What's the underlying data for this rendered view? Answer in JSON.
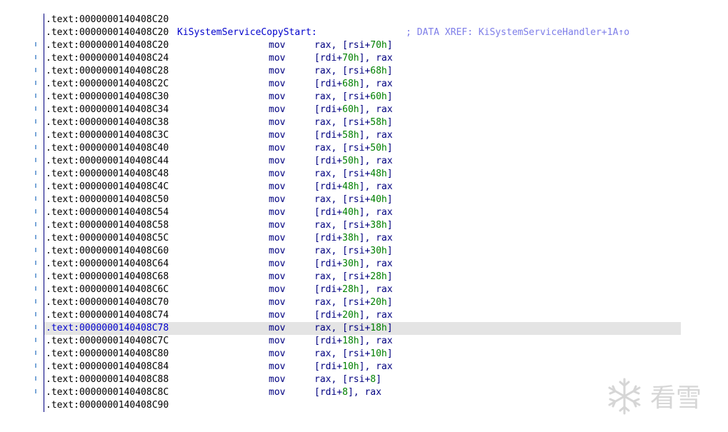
{
  "listing": [
    {
      "addr": ".text:0000000140408C20",
      "label": "",
      "xref": "",
      "mnem": "",
      "ops": "",
      "flow": false,
      "selected": false
    },
    {
      "addr": ".text:0000000140408C20",
      "label": "KiSystemServiceCopyStart:",
      "xref": "; DATA XREF: KiSystemServiceHandler+1A↑o",
      "mnem": "",
      "ops": "",
      "flow": false,
      "selected": false
    },
    {
      "addr": ".text:0000000140408C20",
      "label": "",
      "xref": "",
      "mnem": "mov",
      "ops": "rax, [rsi+70h]",
      "flow": true,
      "selected": false
    },
    {
      "addr": ".text:0000000140408C24",
      "label": "",
      "xref": "",
      "mnem": "mov",
      "ops": "[rdi+70h], rax",
      "flow": true,
      "selected": false
    },
    {
      "addr": ".text:0000000140408C28",
      "label": "",
      "xref": "",
      "mnem": "mov",
      "ops": "rax, [rsi+68h]",
      "flow": true,
      "selected": false
    },
    {
      "addr": ".text:0000000140408C2C",
      "label": "",
      "xref": "",
      "mnem": "mov",
      "ops": "[rdi+68h], rax",
      "flow": true,
      "selected": false
    },
    {
      "addr": ".text:0000000140408C30",
      "label": "",
      "xref": "",
      "mnem": "mov",
      "ops": "rax, [rsi+60h]",
      "flow": true,
      "selected": false
    },
    {
      "addr": ".text:0000000140408C34",
      "label": "",
      "xref": "",
      "mnem": "mov",
      "ops": "[rdi+60h], rax",
      "flow": true,
      "selected": false
    },
    {
      "addr": ".text:0000000140408C38",
      "label": "",
      "xref": "",
      "mnem": "mov",
      "ops": "rax, [rsi+58h]",
      "flow": true,
      "selected": false
    },
    {
      "addr": ".text:0000000140408C3C",
      "label": "",
      "xref": "",
      "mnem": "mov",
      "ops": "[rdi+58h], rax",
      "flow": true,
      "selected": false
    },
    {
      "addr": ".text:0000000140408C40",
      "label": "",
      "xref": "",
      "mnem": "mov",
      "ops": "rax, [rsi+50h]",
      "flow": true,
      "selected": false
    },
    {
      "addr": ".text:0000000140408C44",
      "label": "",
      "xref": "",
      "mnem": "mov",
      "ops": "[rdi+50h], rax",
      "flow": true,
      "selected": false
    },
    {
      "addr": ".text:0000000140408C48",
      "label": "",
      "xref": "",
      "mnem": "mov",
      "ops": "rax, [rsi+48h]",
      "flow": true,
      "selected": false
    },
    {
      "addr": ".text:0000000140408C4C",
      "label": "",
      "xref": "",
      "mnem": "mov",
      "ops": "[rdi+48h], rax",
      "flow": true,
      "selected": false
    },
    {
      "addr": ".text:0000000140408C50",
      "label": "",
      "xref": "",
      "mnem": "mov",
      "ops": "rax, [rsi+40h]",
      "flow": true,
      "selected": false
    },
    {
      "addr": ".text:0000000140408C54",
      "label": "",
      "xref": "",
      "mnem": "mov",
      "ops": "[rdi+40h], rax",
      "flow": true,
      "selected": false
    },
    {
      "addr": ".text:0000000140408C58",
      "label": "",
      "xref": "",
      "mnem": "mov",
      "ops": "rax, [rsi+38h]",
      "flow": true,
      "selected": false
    },
    {
      "addr": ".text:0000000140408C5C",
      "label": "",
      "xref": "",
      "mnem": "mov",
      "ops": "[rdi+38h], rax",
      "flow": true,
      "selected": false
    },
    {
      "addr": ".text:0000000140408C60",
      "label": "",
      "xref": "",
      "mnem": "mov",
      "ops": "rax, [rsi+30h]",
      "flow": true,
      "selected": false
    },
    {
      "addr": ".text:0000000140408C64",
      "label": "",
      "xref": "",
      "mnem": "mov",
      "ops": "[rdi+30h], rax",
      "flow": true,
      "selected": false
    },
    {
      "addr": ".text:0000000140408C68",
      "label": "",
      "xref": "",
      "mnem": "mov",
      "ops": "rax, [rsi+28h]",
      "flow": true,
      "selected": false
    },
    {
      "addr": ".text:0000000140408C6C",
      "label": "",
      "xref": "",
      "mnem": "mov",
      "ops": "[rdi+28h], rax",
      "flow": true,
      "selected": false
    },
    {
      "addr": ".text:0000000140408C70",
      "label": "",
      "xref": "",
      "mnem": "mov",
      "ops": "rax, [rsi+20h]",
      "flow": true,
      "selected": false
    },
    {
      "addr": ".text:0000000140408C74",
      "label": "",
      "xref": "",
      "mnem": "mov",
      "ops": "[rdi+20h], rax",
      "flow": true,
      "selected": false
    },
    {
      "addr": ".text:0000000140408C78",
      "label": "",
      "xref": "",
      "mnem": "mov",
      "ops": "rax, [rsi+18h]",
      "flow": true,
      "selected": true
    },
    {
      "addr": ".text:0000000140408C7C",
      "label": "",
      "xref": "",
      "mnem": "mov",
      "ops": "[rdi+18h], rax",
      "flow": true,
      "selected": false
    },
    {
      "addr": ".text:0000000140408C80",
      "label": "",
      "xref": "",
      "mnem": "mov",
      "ops": "rax, [rsi+10h]",
      "flow": true,
      "selected": false
    },
    {
      "addr": ".text:0000000140408C84",
      "label": "",
      "xref": "",
      "mnem": "mov",
      "ops": "[rdi+10h], rax",
      "flow": true,
      "selected": false
    },
    {
      "addr": ".text:0000000140408C88",
      "label": "",
      "xref": "",
      "mnem": "mov",
      "ops": "rax, [rsi+8]",
      "flow": true,
      "selected": false
    },
    {
      "addr": ".text:0000000140408C8C",
      "label": "",
      "xref": "",
      "mnem": "mov",
      "ops": "[rdi+8], rax",
      "flow": true,
      "selected": false
    },
    {
      "addr": ".text:0000000140408C90",
      "label": "",
      "xref": "",
      "mnem": "",
      "ops": "",
      "flow": false,
      "selected": false
    }
  ],
  "watermark": {
    "icon": "snowflake-icon",
    "text": "看雪"
  },
  "colors": {
    "address": "#000000",
    "label": "#0000cc",
    "xref_comment": "#7d7de8",
    "instruction": "#000080",
    "number": "#008000",
    "selected_line": "#e4e4e4",
    "watermark": "#d6d6d6"
  }
}
